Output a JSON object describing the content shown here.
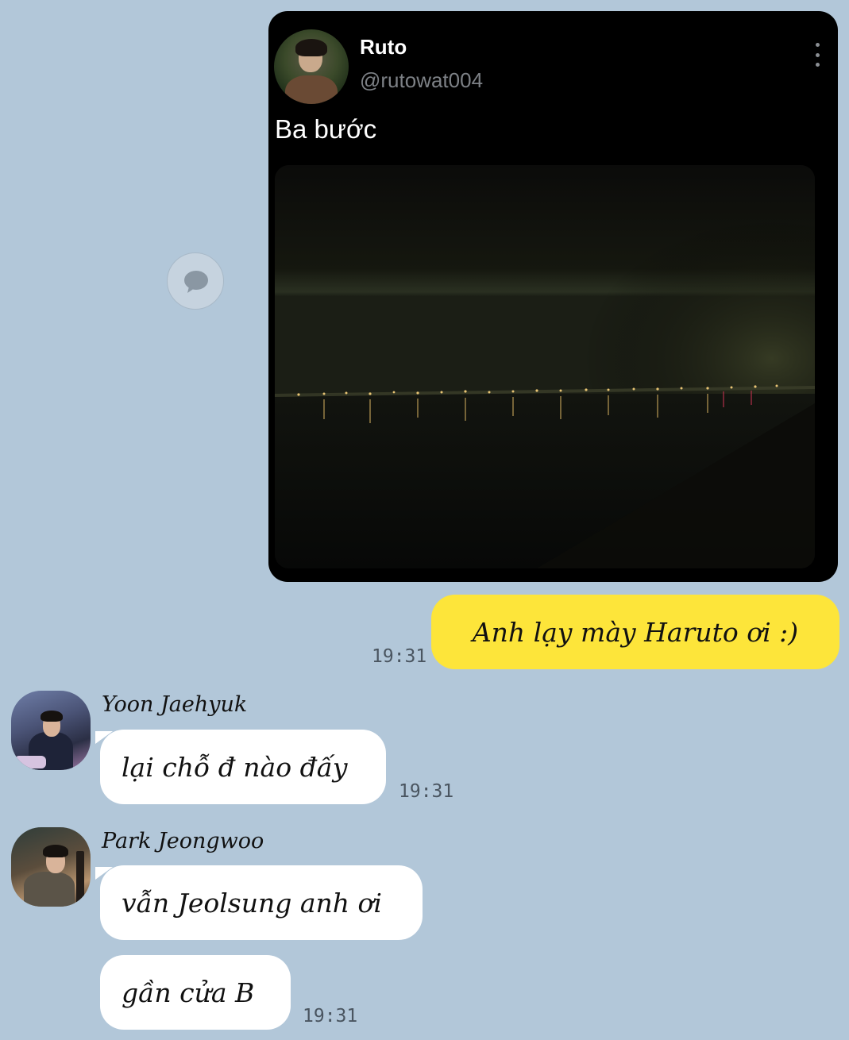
{
  "tweet": {
    "name": "Ruto",
    "handle": "@rutowat004",
    "text": "Ba bước",
    "avatar_icon": "profile-photo",
    "menu_icon": "more-vertical-icon",
    "photo_subject": "night-riverside-city-lights"
  },
  "share_button": {
    "icon": "speech-bubble-icon"
  },
  "messages": [
    {
      "side": "right",
      "text": "Anh lạy mày Haruto ơi :)",
      "time": "19:31",
      "color": "#fde53a"
    },
    {
      "side": "left",
      "sender": "Yoon Jaehyuk",
      "text": "lại chỗ đ nào đấy",
      "time": "19:31"
    },
    {
      "side": "left",
      "sender": "Park Jeongwoo",
      "text": "vẫn Jeolsung anh ơi",
      "time": ""
    },
    {
      "side": "left",
      "sender": "",
      "text": "gần cửa B",
      "time": "19:31"
    }
  ],
  "colors": {
    "background": "#b2c7d9",
    "my_bubble": "#fde53a",
    "their_bubble": "#ffffff",
    "card": "#000000"
  }
}
